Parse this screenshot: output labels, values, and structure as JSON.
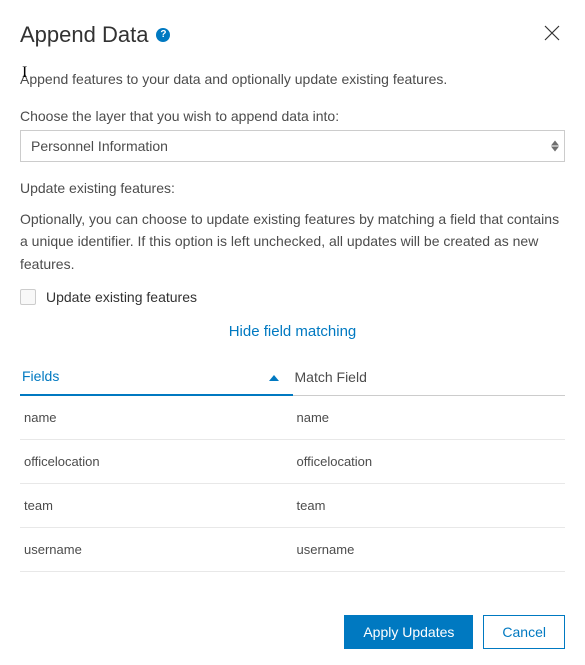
{
  "header": {
    "title": "Append Data",
    "help_tooltip": "?"
  },
  "description": "Append features to your data and optionally update existing features.",
  "layer_select": {
    "label": "Choose the layer that you wish to append data into:",
    "selected": "Personnel Information"
  },
  "update_section": {
    "heading": "Update existing features:",
    "help_text": "Optionally, you can choose to update existing features by matching a field that contains a unique identifier. If this option is left unchecked, all updates will be created as new features.",
    "checkbox_label": "Update existing features"
  },
  "toggle_link": "Hide field matching",
  "table": {
    "col_fields": "Fields",
    "col_match": "Match Field",
    "rows": [
      {
        "field": "name",
        "match": "name"
      },
      {
        "field": "officelocation",
        "match": "officelocation"
      },
      {
        "field": "team",
        "match": "team"
      },
      {
        "field": "username",
        "match": "username"
      }
    ]
  },
  "footer": {
    "apply": "Apply Updates",
    "cancel": "Cancel"
  }
}
